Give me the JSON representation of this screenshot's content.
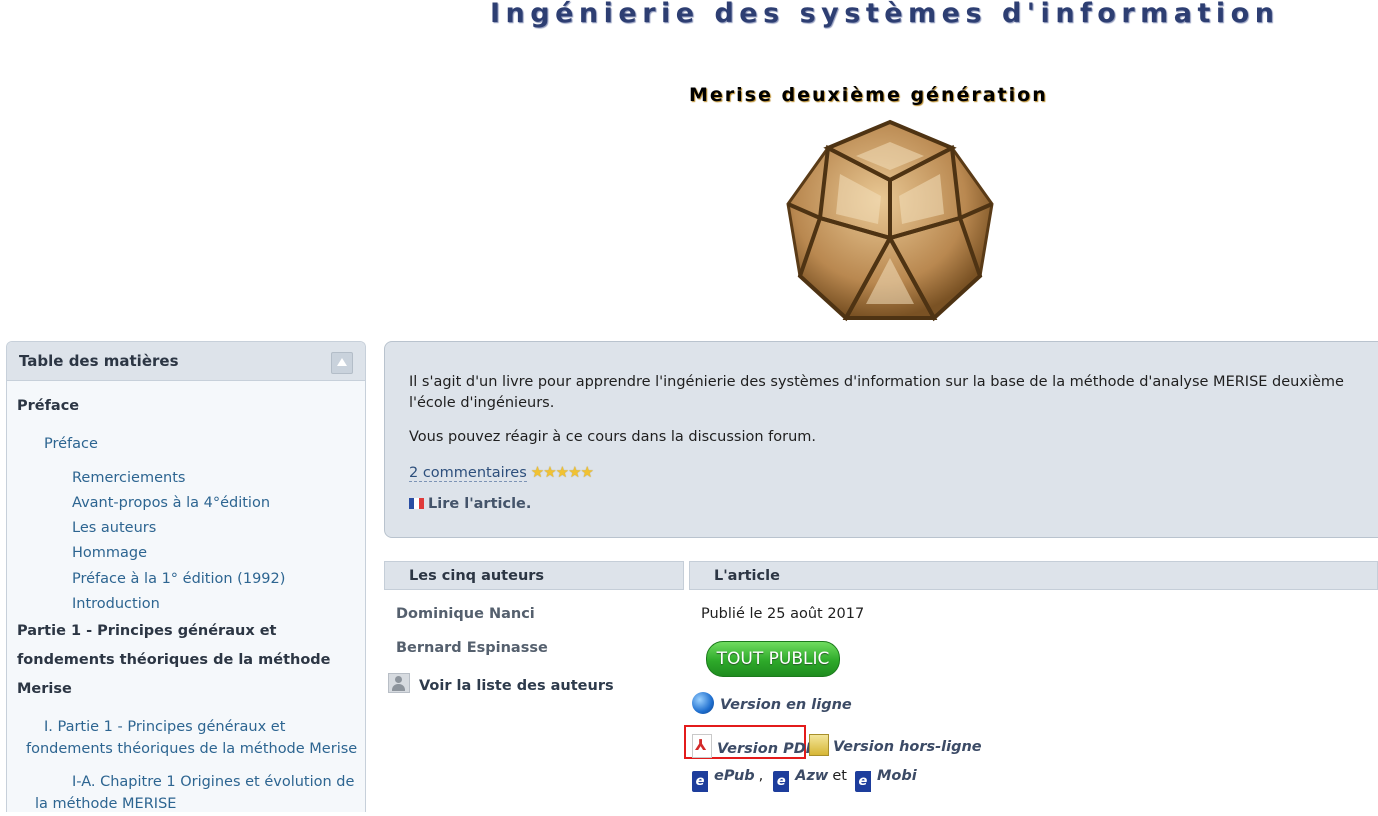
{
  "site": {
    "title": "Ingénierie des systèmes d'information"
  },
  "book": {
    "title": "Merise deuxième génération",
    "image_name": "icosahedron-wood-model"
  },
  "toc": {
    "title": "Table des matières",
    "collapse_icon": "collapse-up-icon",
    "items": [
      {
        "label": "Préface",
        "level": 0
      },
      {
        "label": "Préface",
        "level": 1
      },
      {
        "label": "Remerciements",
        "level": 2
      },
      {
        "label": "Avant-propos à la 4°édition",
        "level": 2
      },
      {
        "label": "Les auteurs",
        "level": 2
      },
      {
        "label": "Hommage",
        "level": 2
      },
      {
        "label": "Préface à la 1° édition (1992)",
        "level": 2
      },
      {
        "label": "Introduction",
        "level": 2
      },
      {
        "label": "Partie 1 - Principes généraux et fondements théoriques de la méthode Merise",
        "level": 0
      },
      {
        "label": "I. Partie 1 - Principes généraux et fondements théoriques de la méthode Merise",
        "level": 1
      },
      {
        "label": "I-A. Chapitre 1 Origines et évolution de la méthode MERISE",
        "level": 2
      }
    ]
  },
  "description": {
    "line1": "Il s'agit d'un livre pour apprendre l'ingénierie des systèmes d'information sur la base de la méthode d'analyse MERISE deuxième",
    "line2": "l'école d'ingénieurs.",
    "line3": "Vous pouvez réagir à ce cours dans la discussion forum.",
    "comments_link": "2 commentaires",
    "stars": "★★★★★",
    "rating": 5,
    "read_link": "Lire l'article."
  },
  "authors_section": {
    "header": "Les cinq auteurs",
    "authors": [
      "Dominique Nanci",
      "Bernard Espinasse"
    ],
    "list_link": "Voir la liste des auteurs"
  },
  "article_section": {
    "header": "L'article",
    "published": "Publié le 25 août 2017",
    "audience_badge": "TOUT PUBLIC",
    "online_version": "Version en ligne",
    "pdf_version": "Version PDF",
    "offline_version": "Version hors-ligne",
    "epub": "ePub",
    "comma": ",",
    "azw": "Azw",
    "and_word": "et",
    "mobi": "Mobi"
  },
  "colors": {
    "title": "#2d3e72",
    "panel": "#dde3ea",
    "link": "#2d6591",
    "highlight_box": "#e31b1b",
    "badge": "#2eaa2a"
  }
}
